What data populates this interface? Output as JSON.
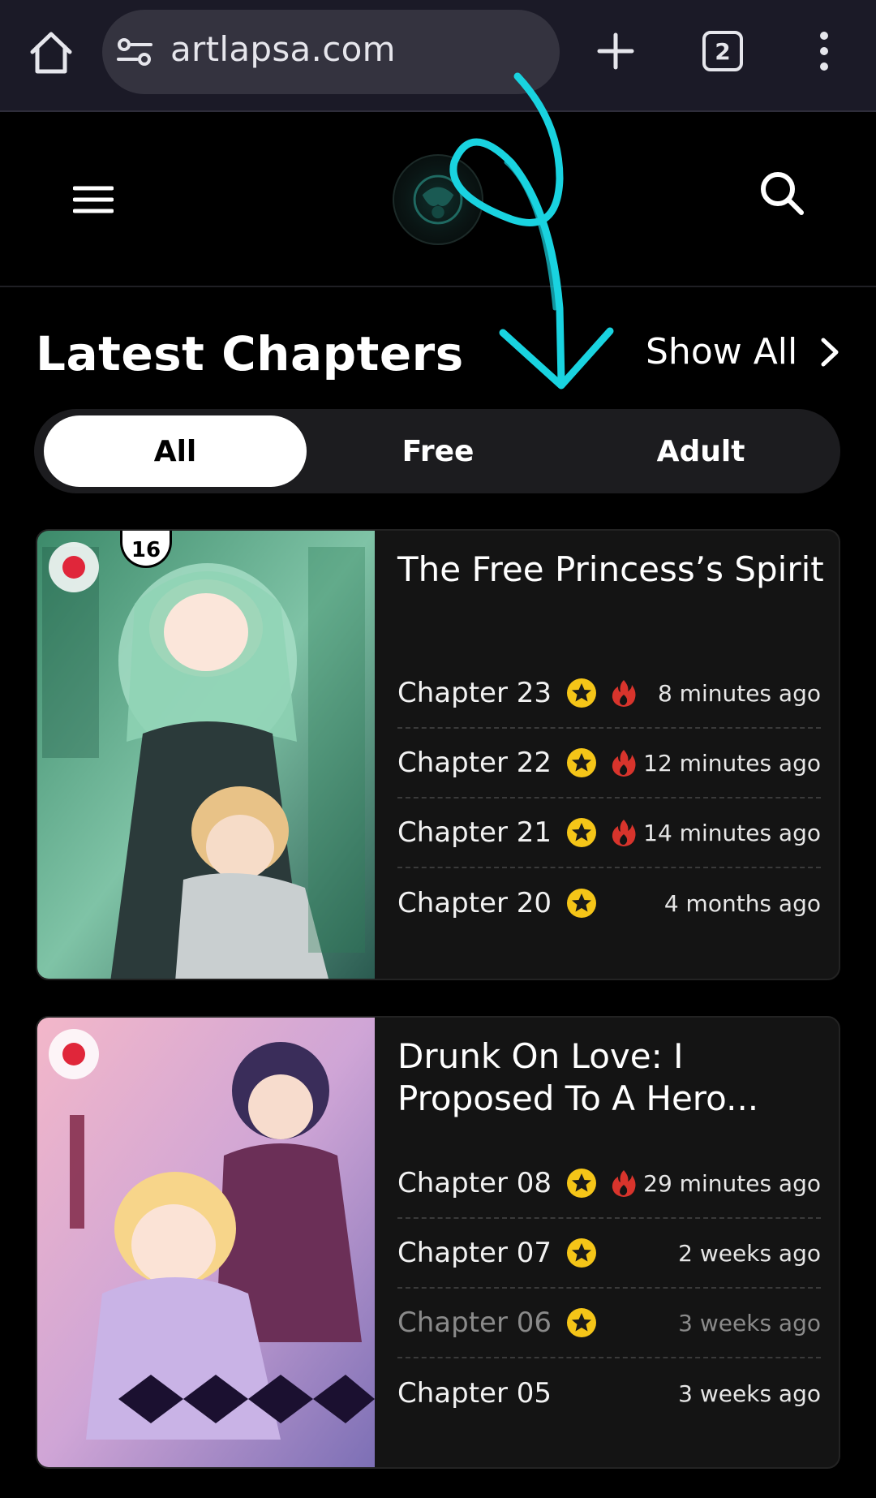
{
  "browser": {
    "url": "artlapsa.com",
    "tab_count": "2"
  },
  "header": {
    "section_title": "Latest Chapters",
    "show_all_label": "Show All"
  },
  "filters": [
    {
      "label": "All",
      "active": true
    },
    {
      "label": "Free",
      "active": false
    },
    {
      "label": "Adult",
      "active": false
    }
  ],
  "manga": [
    {
      "title": "The Free Princess’s Spirit",
      "cover_badge": "16",
      "chapters": [
        {
          "name": "Chapter 23",
          "time": "8 minutes ago",
          "star": true,
          "hot": true,
          "dim": false
        },
        {
          "name": "Chapter 22",
          "time": "12 minutes ago",
          "star": true,
          "hot": true,
          "dim": false
        },
        {
          "name": "Chapter 21",
          "time": "14 minutes ago",
          "star": true,
          "hot": true,
          "dim": false
        },
        {
          "name": "Chapter 20",
          "time": "4 months ago",
          "star": true,
          "hot": false,
          "dim": false
        }
      ]
    },
    {
      "title": "Drunk On Love: I Proposed To A Hero...",
      "chapters": [
        {
          "name": "Chapter 08",
          "time": "29 minutes ago",
          "star": true,
          "hot": true,
          "dim": false
        },
        {
          "name": "Chapter 07",
          "time": "2 weeks ago",
          "star": true,
          "hot": false,
          "dim": false
        },
        {
          "name": "Chapter 06",
          "time": "3 weeks ago",
          "star": true,
          "hot": false,
          "dim": true
        },
        {
          "name": "Chapter 05",
          "time": "3 weeks ago",
          "star": false,
          "hot": false,
          "dim": false
        }
      ]
    }
  ],
  "colors": {
    "browser_bg": "#1b1a27",
    "page_bg": "#000000",
    "card_bg": "#141414",
    "star": "#f5c518",
    "fire": "#d8342c",
    "annotation": "#19d3e0"
  },
  "icons": [
    "home-icon",
    "site-settings-icon",
    "plus-icon",
    "tabs-icon",
    "more-vert-icon",
    "hamburger-icon",
    "search-icon",
    "chevron-right-icon",
    "star-icon",
    "fire-icon"
  ]
}
